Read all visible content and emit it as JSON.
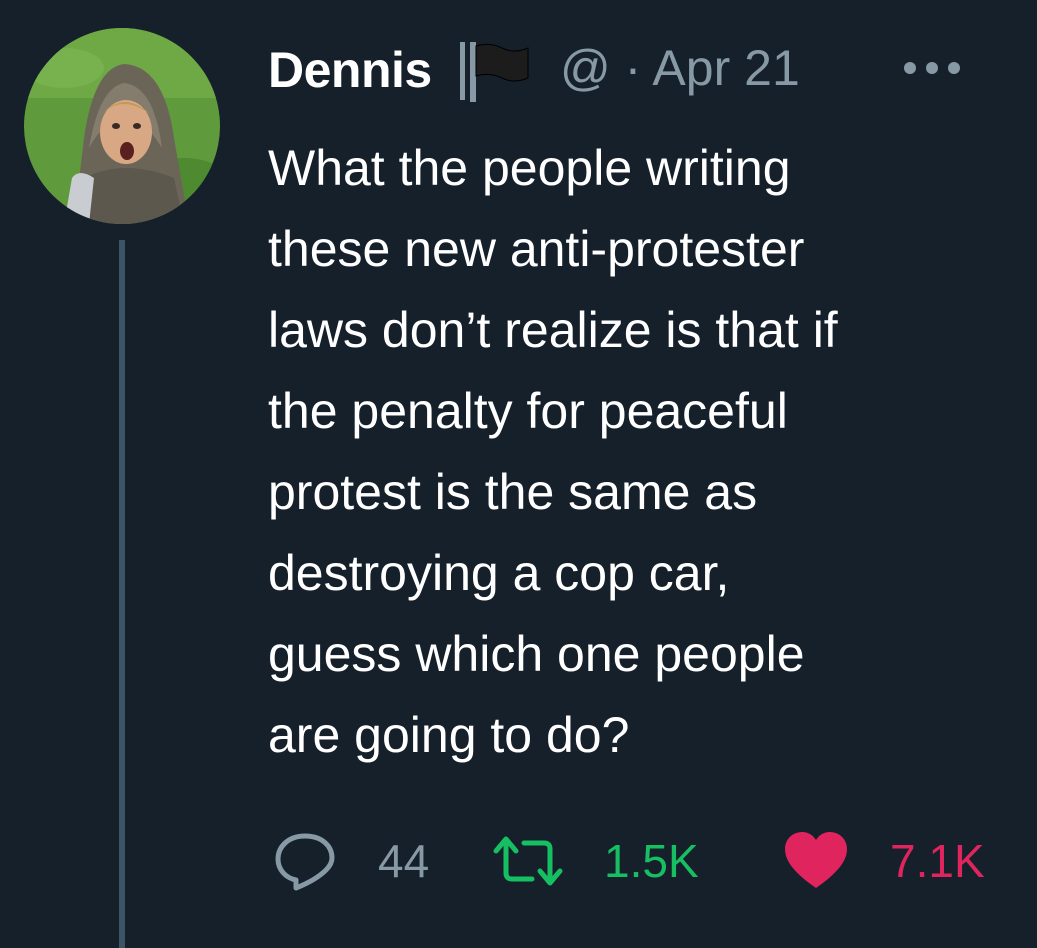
{
  "tweet": {
    "display_name": "Dennis",
    "handle_fragment": "@ · Apr 21",
    "text_lines": [
      "What the people writing",
      "these new anti-protester",
      "laws don’t realize is that if",
      "the penalty for peaceful",
      "protest is the same as",
      "destroying a cop car,",
      "guess which one people",
      "are going to do?"
    ]
  },
  "actions": {
    "reply_count": "44",
    "retweet_count": "1.5K",
    "like_count": "7.1K"
  },
  "icons": {
    "reply": "speech-bubble-icon",
    "retweet": "retweet-arrows-icon",
    "like": "heart-icon",
    "more": "ellipsis-icon",
    "flag": "black-flag-icon"
  },
  "colors": {
    "background": "#15202b",
    "text": "#ffffff",
    "secondary": "#8899a6",
    "retweet": "#17bf63",
    "like": "#e0245e",
    "thread_line": "#3d5466"
  }
}
